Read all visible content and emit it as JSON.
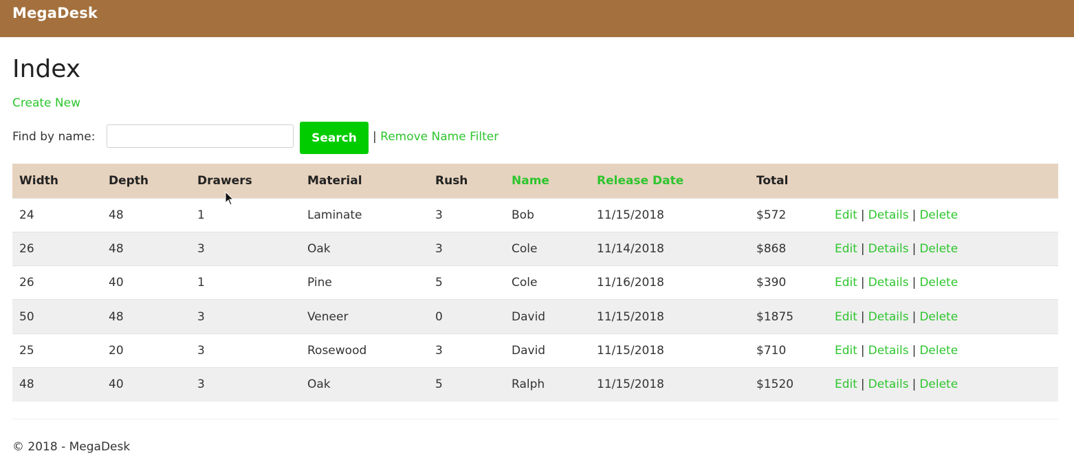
{
  "navbar": {
    "brand": "MegaDesk"
  },
  "page": {
    "title": "Index",
    "create_new": "Create New"
  },
  "filter": {
    "label": "Find by name:",
    "value": "",
    "placeholder": "",
    "search_label": "Search",
    "separator": "|",
    "remove_label": "Remove Name Filter"
  },
  "table": {
    "headers": [
      "Width",
      "Depth",
      "Drawers",
      "Material",
      "Rush",
      "Name",
      "Release Date",
      "Total",
      ""
    ],
    "sortable_headers": [
      "Name",
      "Release Date"
    ],
    "rows": [
      [
        "24",
        "48",
        "1",
        "Laminate",
        "3",
        "Bob",
        "11/15/2018",
        "$572"
      ],
      [
        "26",
        "48",
        "3",
        "Oak",
        "3",
        "Cole",
        "11/14/2018",
        "$868"
      ],
      [
        "26",
        "40",
        "1",
        "Pine",
        "5",
        "Cole",
        "11/16/2018",
        "$390"
      ],
      [
        "50",
        "48",
        "3",
        "Veneer",
        "0",
        "David",
        "11/15/2018",
        "$1875"
      ],
      [
        "25",
        "20",
        "3",
        "Rosewood",
        "3",
        "David",
        "11/15/2018",
        "$710"
      ],
      [
        "48",
        "40",
        "3",
        "Oak",
        "5",
        "Ralph",
        "11/15/2018",
        "$1520"
      ]
    ],
    "actions": {
      "edit": "Edit",
      "details": "Details",
      "delete": "Delete",
      "separator": "|"
    }
  },
  "footer": {
    "text": "© 2018 - MegaDesk"
  },
  "colors": {
    "navbar": "#a4703d",
    "link": "#2ec52e",
    "search_button": "#00cc00",
    "table_header": "#e6d3bf",
    "row_stripe": "#efefef"
  }
}
